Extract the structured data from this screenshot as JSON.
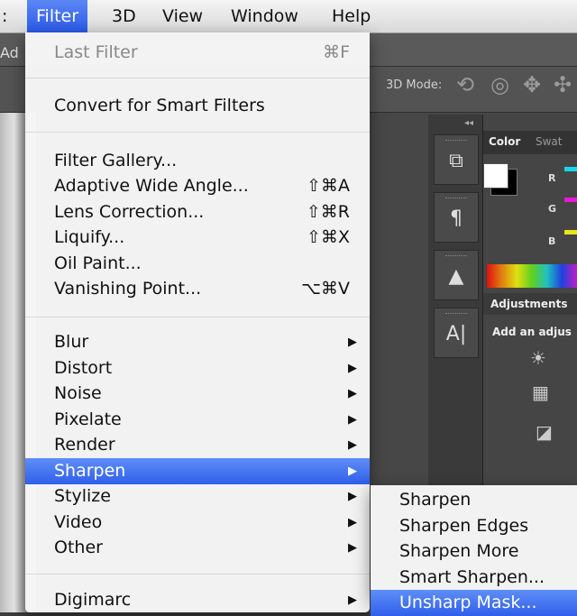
{
  "menubar": {
    "items": [
      {
        "label": ":",
        "active": false
      },
      {
        "label": "Filter",
        "active": true
      },
      {
        "label": "3D",
        "active": false
      },
      {
        "label": "View",
        "active": false
      },
      {
        "label": "Window",
        "active": false
      },
      {
        "label": "Help",
        "active": false
      }
    ]
  },
  "app": {
    "edge_text": "Ad",
    "mode_label": "3D Mode:",
    "panels": {
      "tab_active": "Color",
      "tab_inactive": "Swat",
      "r": "R",
      "g": "G",
      "b": "B",
      "adjustments_title": "Adjustments",
      "adjustments_text": "Add an adjus",
      "tool_text_icon": "A|"
    }
  },
  "filter_menu": {
    "last_filter": {
      "label": "Last Filter",
      "shortcut": "⌘F"
    },
    "convert": {
      "label": "Convert for Smart Filters"
    },
    "group1": [
      {
        "label": "Filter Gallery...",
        "shortcut": ""
      },
      {
        "label": "Adaptive Wide Angle...",
        "shortcut": "⇧⌘A"
      },
      {
        "label": "Lens Correction...",
        "shortcut": "⇧⌘R"
      },
      {
        "label": "Liquify...",
        "shortcut": "⇧⌘X"
      },
      {
        "label": "Oil Paint...",
        "shortcut": ""
      },
      {
        "label": "Vanishing Point...",
        "shortcut": "⌥⌘V"
      }
    ],
    "group2": [
      "Blur",
      "Distort",
      "Noise",
      "Pixelate",
      "Render",
      "Sharpen",
      "Stylize",
      "Video",
      "Other"
    ],
    "group3": [
      "Digimarc"
    ],
    "arrow": "▶"
  },
  "sharpen_submenu": {
    "items": [
      "Sharpen",
      "Sharpen Edges",
      "Sharpen More",
      "Smart Sharpen...",
      "Unsharp Mask..."
    ]
  }
}
